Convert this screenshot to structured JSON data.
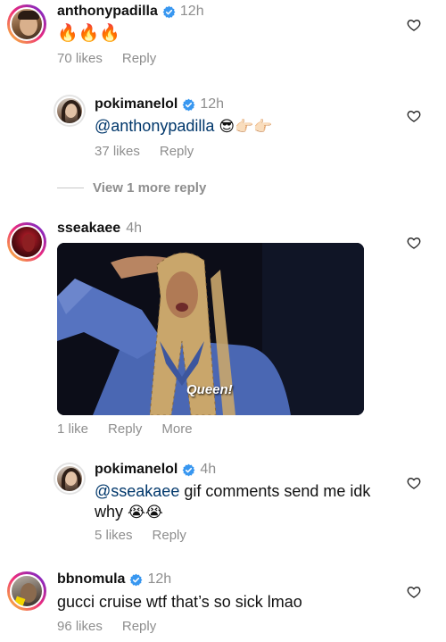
{
  "colors": {
    "text": "#111111",
    "muted": "#8e8e8e",
    "mention": "#00376b",
    "verified": "#3897f0",
    "ring_gradient": [
      "#f9ce34",
      "#ee2a7b",
      "#6228d7"
    ]
  },
  "comments": [
    {
      "username": "anthonypadilla",
      "verified": true,
      "time": "12h",
      "text_emoji": "🔥🔥🔥",
      "likes": "70 likes",
      "reply": "Reply",
      "icon": "heart-outline-icon"
    },
    {
      "username": "pokimanelol",
      "verified": true,
      "time": "12h",
      "mention": "@anthonypadilla",
      "text_emoji": "😎👉🏻👉🏻",
      "likes": "37 likes",
      "reply": "Reply",
      "icon": "heart-outline-icon"
    },
    {
      "username": "sseakaee",
      "verified": false,
      "time": "4h",
      "gif_caption": "Queen!",
      "likes": "1 like",
      "reply": "Reply",
      "more": "More",
      "icon": "heart-outline-icon"
    },
    {
      "username": "pokimanelol",
      "verified": true,
      "time": "4h",
      "mention": "@sseakaee",
      "text_line1": " gif comments send me idk",
      "text_line2": "why",
      "text_emoji": "😭😭",
      "likes": "5 likes",
      "reply": "Reply",
      "icon": "heart-outline-icon"
    },
    {
      "username": "bbnomula",
      "verified": true,
      "time": "12h",
      "text": "gucci cruise wtf that’s so sick lmao",
      "likes": "96 likes",
      "reply": "Reply",
      "icon": "heart-outline-icon"
    }
  ],
  "view_more": "View 1 more reply"
}
